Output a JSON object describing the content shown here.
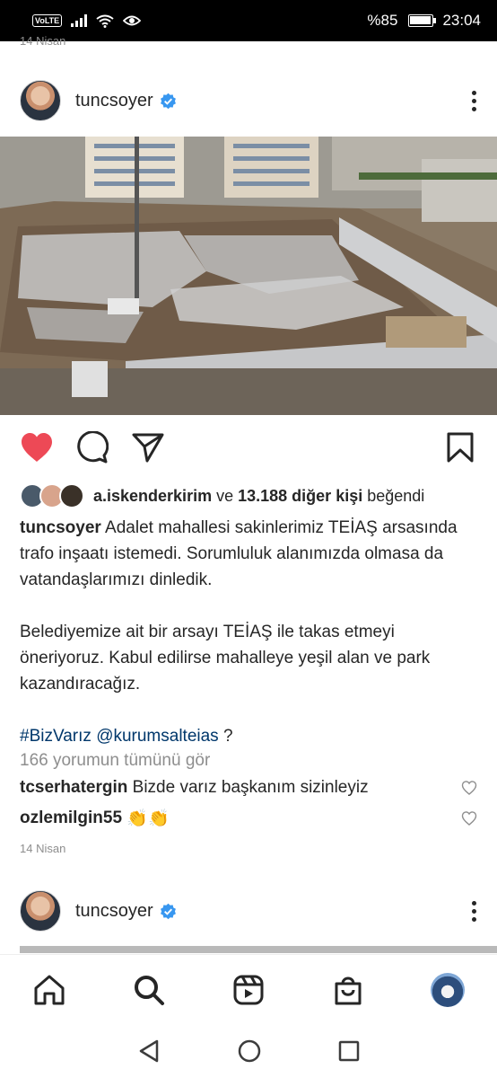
{
  "status_bar": {
    "volte": "VoLTE",
    "battery": "%85",
    "time": "23:04"
  },
  "prev_post_date": "14 Nisan",
  "post": {
    "username": "tuncsoyer",
    "likes": {
      "liker": "a.iskenderkirim",
      "joiner": "ve",
      "others": "13.188 diğer kişi",
      "suffix": "beğendi"
    },
    "caption": {
      "username": "tuncsoyer",
      "p1": "Adalet mahallesi sakinlerimiz TEİAŞ arsasında trafo inşaatı istemedi. Sorumluluk alanımızda olmasa da vatandaşlarımızı dinledik.",
      "p2": "Belediyemize ait bir arsayı TEİAŞ ile takas etmeyi öneriyoruz. Kabul edilirse mahalleye yeşil alan ve park kazandıracağız.",
      "hashtag": "#BizVarız",
      "mention": "@kurumsalteias",
      "tail": "?"
    },
    "view_all_comments": "166 yorumun tümünü gör",
    "comments": [
      {
        "user": "tcserhatergin",
        "text": "Bizde varız başkanım sizinleyiz"
      },
      {
        "user": "ozlemilgin55",
        "text": "👏👏"
      }
    ],
    "date": "14 Nisan"
  },
  "next_post": {
    "username": "tuncsoyer"
  },
  "colors": {
    "like_red": "#ed4956",
    "verified_blue": "#3897f0",
    "link_blue": "#00376b",
    "muted": "#8e8e8e"
  },
  "icons": {
    "action_bar": [
      "heart-icon",
      "comment-icon",
      "share-icon",
      "bookmark-icon"
    ],
    "bottom_nav": [
      "home-icon",
      "search-icon",
      "reels-icon",
      "shop-icon",
      "profile-avatar"
    ],
    "system_nav": [
      "back-icon",
      "home-circle-icon",
      "recents-icon"
    ]
  }
}
